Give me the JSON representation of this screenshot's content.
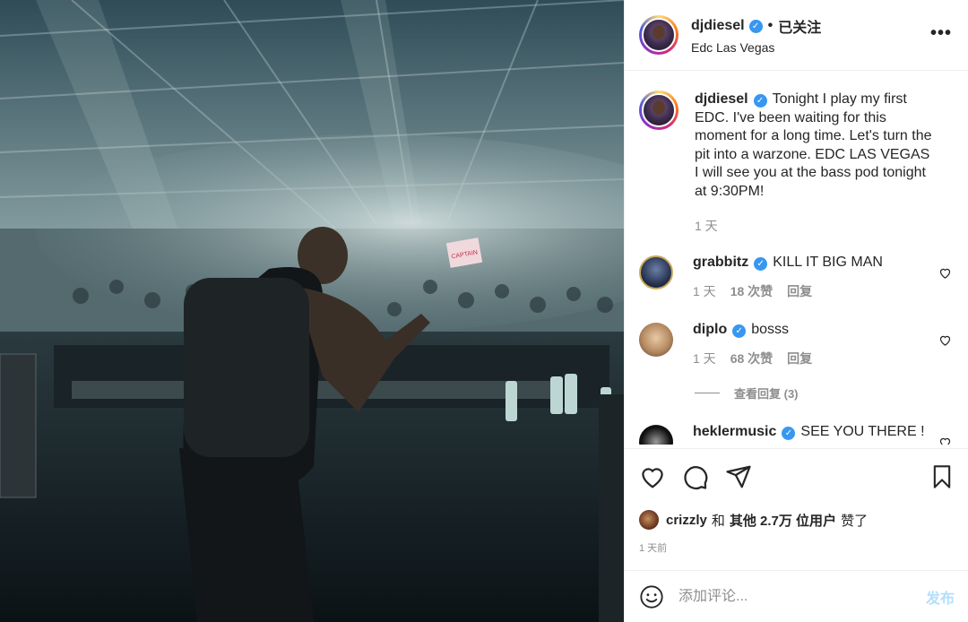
{
  "post": {
    "photo_alt": "DJ performing at EDC Las Vegas",
    "banner_text": "CAPTAIN BASS"
  },
  "header": {
    "username": "djdiesel",
    "verified_mark": "✓",
    "separator": "•",
    "follow_status": "已关注",
    "location": "Edc Las Vegas",
    "more_icon": "more-dots-icon",
    "more_glyph": "•••"
  },
  "caption": {
    "username": "djdiesel",
    "text": "Tonight I play my first EDC. I've been waiting for this moment for a long time. Let's turn the pit into a warzone. EDC LAS VEGAS I will see you at the bass pod tonight at 9:30PM!",
    "time": "1 天"
  },
  "comments": [
    {
      "username": "grabbitz",
      "text": "KILL IT BIG MAN",
      "time": "1 天",
      "likes": "18 次赞",
      "reply": "回复"
    },
    {
      "username": "diplo",
      "text": "bosss",
      "time": "1 天",
      "likes": "68 次赞",
      "reply": "回复",
      "view_replies": "查看回复 (3)"
    },
    {
      "username": "heklermusic",
      "text": "SEE YOU THERE !"
    }
  ],
  "actions": {
    "like_icon": "heart-icon",
    "comment_icon": "comment-icon",
    "share_icon": "paper-plane-icon",
    "save_icon": "bookmark-icon"
  },
  "likes": {
    "first_user": "crizzly",
    "and": "和",
    "others": "其他 2.7万 位用户",
    "suffix": "赞了"
  },
  "posted_time": "1 天前",
  "add_comment": {
    "emoji_icon": "emoji-icon",
    "placeholder": "添加评论...",
    "post_label": "发布",
    "post_color": "#b2dffc"
  },
  "colors": {
    "verified": "#3897f0",
    "muted": "#8e8e8e",
    "text": "#262626"
  }
}
